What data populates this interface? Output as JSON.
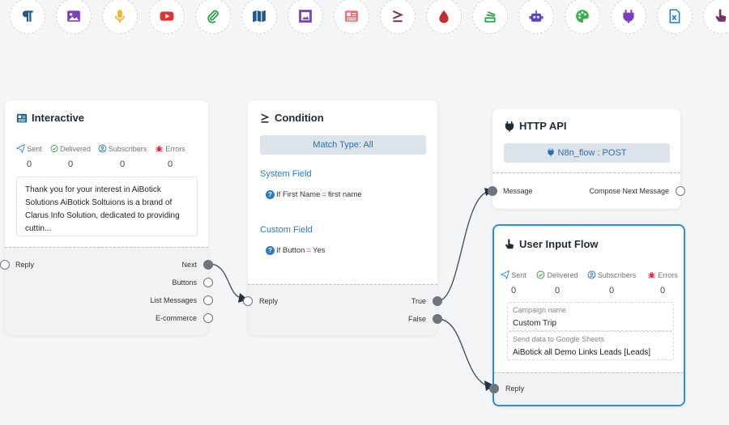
{
  "toolbar": {
    "tools": [
      {
        "name": "paragraph-icon",
        "color": "#1f5a8a"
      },
      {
        "name": "image-icon",
        "color": "#7b3fbf"
      },
      {
        "name": "microphone-icon",
        "color": "#f0b429"
      },
      {
        "name": "youtube-icon",
        "color": "#e03131"
      },
      {
        "name": "paperclip-icon",
        "color": "#2f9e44"
      },
      {
        "name": "map-icon",
        "color": "#1f5a8a"
      },
      {
        "name": "media-frame-icon",
        "color": "#7b3fbf"
      },
      {
        "name": "newspaper-icon",
        "color": "#f06a6a"
      },
      {
        "name": "greater-equal-icon",
        "color": "#7b2f6a"
      },
      {
        "name": "droplet-icon",
        "color": "#c92a2a"
      },
      {
        "name": "stack-icon",
        "color": "#2f9e44"
      },
      {
        "name": "robot-icon",
        "color": "#5b3fd1"
      },
      {
        "name": "palette-icon",
        "color": "#37b24d"
      },
      {
        "name": "plug-icon",
        "color": "#7b3fbf"
      },
      {
        "name": "excel-file-icon",
        "color": "#1c7ed6"
      },
      {
        "name": "hand-pointer-icon",
        "color": "#7b2f6a"
      }
    ]
  },
  "interactive": {
    "title": "Interactive",
    "stats": [
      {
        "label": "Sent",
        "value": "0",
        "icon": "send-icon",
        "color": "#3b8fd9"
      },
      {
        "label": "Delivered",
        "value": "0",
        "icon": "check-circle-icon",
        "color": "#2f9e44"
      },
      {
        "label": "Subscribers",
        "value": "0",
        "icon": "user-circle-icon",
        "color": "#1c7ed6"
      },
      {
        "label": "Errors",
        "value": "0",
        "icon": "bug-icon",
        "color": "#e03131"
      }
    ],
    "message": "Thank you for your interest in AiBotick Solutions AiBotick Soltuions is a brand of Clarus Info Solution, dedicated to providing cuttin...",
    "ports": {
      "reply": "Reply",
      "next": "Next",
      "buttons": "Buttons",
      "list_messages": "List Messages",
      "ecommerce": "E-commerce"
    }
  },
  "condition": {
    "title": "Condition",
    "match_type": "Match Type: All",
    "system_field_label": "System Field",
    "system_rule": {
      "field": "If First Name",
      "op": "=",
      "value": "first name"
    },
    "custom_field_label": "Custom Field",
    "custom_rule": {
      "field": "If Button",
      "op": "=",
      "value": "Yes"
    },
    "ports": {
      "reply": "Reply",
      "true": "True",
      "false": "False"
    }
  },
  "http_api": {
    "title": "HTTP API",
    "endpoint": "N8n_flow : POST",
    "ports": {
      "message": "Message",
      "compose_next": "Compose Next Message"
    }
  },
  "user_input": {
    "title": "User Input Flow",
    "stats": [
      {
        "label": "Sent",
        "value": "0",
        "icon": "send-icon",
        "color": "#3b8fd9"
      },
      {
        "label": "Delivered",
        "value": "0",
        "icon": "check-circle-icon",
        "color": "#2f9e44"
      },
      {
        "label": "Subscribers",
        "value": "0",
        "icon": "user-circle-icon",
        "color": "#1c7ed6"
      },
      {
        "label": "Errors",
        "value": "0",
        "icon": "bug-icon",
        "color": "#e03131"
      }
    ],
    "campaign_label": "Campaign name",
    "campaign_value": "Custom Trip",
    "sheets_label": "Send data to Google Sheets",
    "sheets_value": "AiBotick all Demo Links Leads [Leads]",
    "ports": {
      "reply": "Reply"
    }
  }
}
